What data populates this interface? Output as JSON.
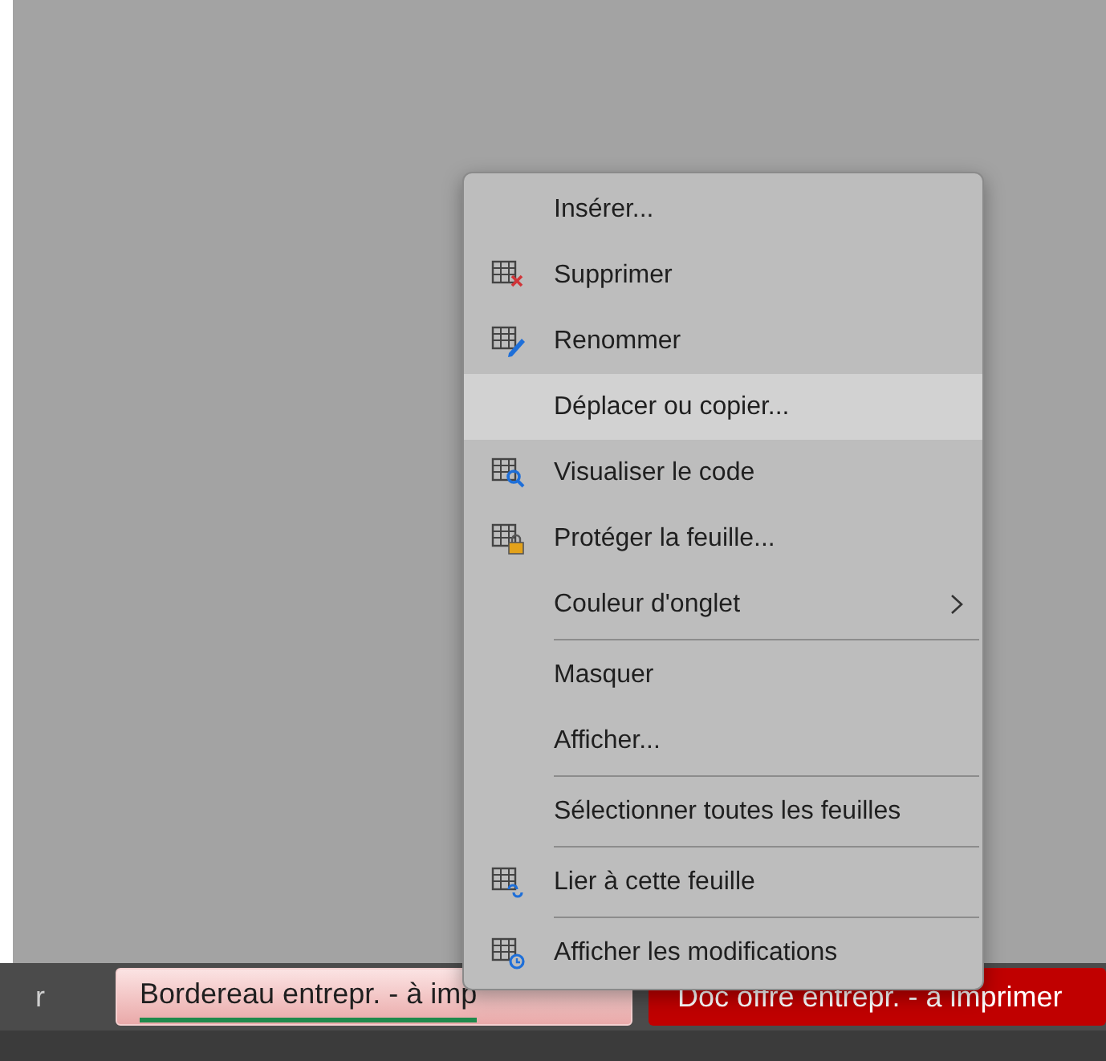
{
  "context_menu": {
    "items": [
      {
        "kind": "item",
        "label": "Insérer...",
        "selected": false
      },
      {
        "kind": "item",
        "label": "Supprimer",
        "selected": false
      },
      {
        "kind": "item",
        "label": "Renommer",
        "selected": false
      },
      {
        "kind": "item",
        "label": "Déplacer ou copier...",
        "selected": true
      },
      {
        "kind": "item",
        "label": "Visualiser le code",
        "selected": false
      },
      {
        "kind": "item",
        "label": "Protéger la feuille...",
        "selected": false
      },
      {
        "kind": "submenu",
        "label": "Couleur d'onglet",
        "selected": false
      },
      {
        "kind": "separator"
      },
      {
        "kind": "item",
        "label": "Masquer",
        "selected": false
      },
      {
        "kind": "item",
        "label": "Afficher...",
        "selected": false
      },
      {
        "kind": "separator"
      },
      {
        "kind": "item",
        "label": "Sélectionner toutes les feuilles",
        "selected": false
      },
      {
        "kind": "separator"
      },
      {
        "kind": "item",
        "label": "Lier à cette feuille",
        "selected": false
      },
      {
        "kind": "separator"
      },
      {
        "kind": "item",
        "label": "Afficher les modifications",
        "selected": false
      }
    ]
  },
  "sheet_tabs": [
    {
      "label": "r",
      "selected": false
    },
    {
      "label": "Bordereau entrepr. - à imp",
      "selected": true
    },
    {
      "label": "Doc offre entrepr. - à imprimer",
      "selected": false,
      "color": "#c00000"
    }
  ]
}
